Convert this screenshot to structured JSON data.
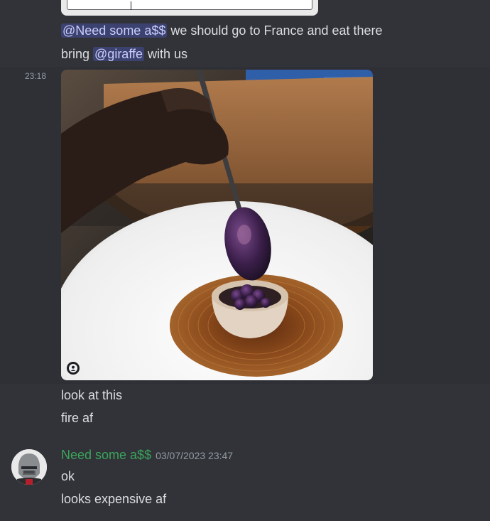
{
  "messages_top": {
    "line1": {
      "mention": "@Need some a$$",
      "text": " we should go to France and eat there"
    },
    "line2": {
      "before": "bring ",
      "mention": "@giraffe",
      "after": " with us"
    }
  },
  "image_message": {
    "time": "23:18",
    "image_alt": "dessert with blueberry spoon",
    "caption1": "look at this",
    "caption2": "fire af"
  },
  "reply_message": {
    "author": "Need some a$$",
    "timestamp": "03/07/2023 23:47",
    "line1": "ok",
    "line2": "looks expensive af"
  },
  "colors": {
    "background": "#313338",
    "mention_bg": "#3c4270",
    "mention_text": "#c9cdfb",
    "author_name": "#3ba55c",
    "muted": "#949ba4"
  }
}
